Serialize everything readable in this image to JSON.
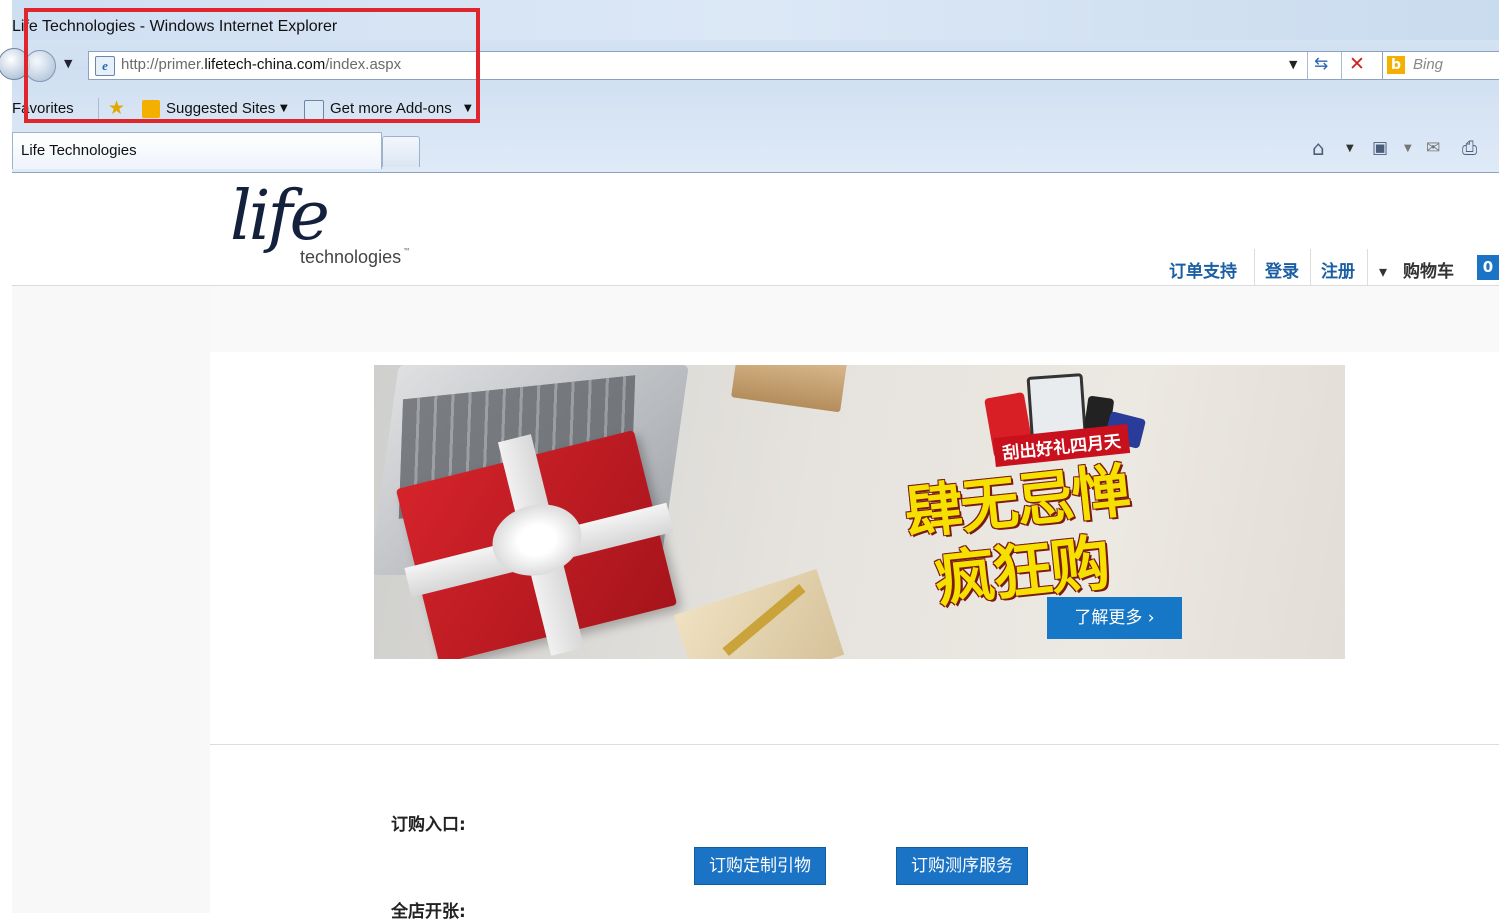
{
  "browser": {
    "window_title": "Life Technologies - Windows Internet Explorer",
    "address_url_prefix": "http://primer.",
    "address_url_domain": "lifetech-china.com",
    "address_url_path": "/index.aspx",
    "search_provider": "Bing",
    "favorites_label": "Favorites",
    "suggested_sites_label": "Suggested Sites",
    "get_addons_label": "Get more Add-ons",
    "active_tab_title": "Life Technologies"
  },
  "site": {
    "logo_main": "life",
    "logo_sub": "technologies",
    "logo_tm": "™",
    "nav": {
      "order_support": "订单支持",
      "login": "登录",
      "register": "注册",
      "cart": "购物车",
      "cart_count": "0"
    },
    "banner": {
      "tag": "刮出好礼四月天",
      "headline_line1": "肆无忌惮",
      "headline_line2": "疯狂购",
      "cta": "了解更多 ›"
    },
    "order": {
      "label": "订购入口:",
      "btn_primers": "订购定制引物",
      "btn_sequencing": "订购测序服务",
      "shop_label": "全店开张:"
    }
  },
  "colors": {
    "highlight": "#e0262d",
    "link_blue": "#1b5fa3",
    "button_blue": "#1a73c5"
  }
}
